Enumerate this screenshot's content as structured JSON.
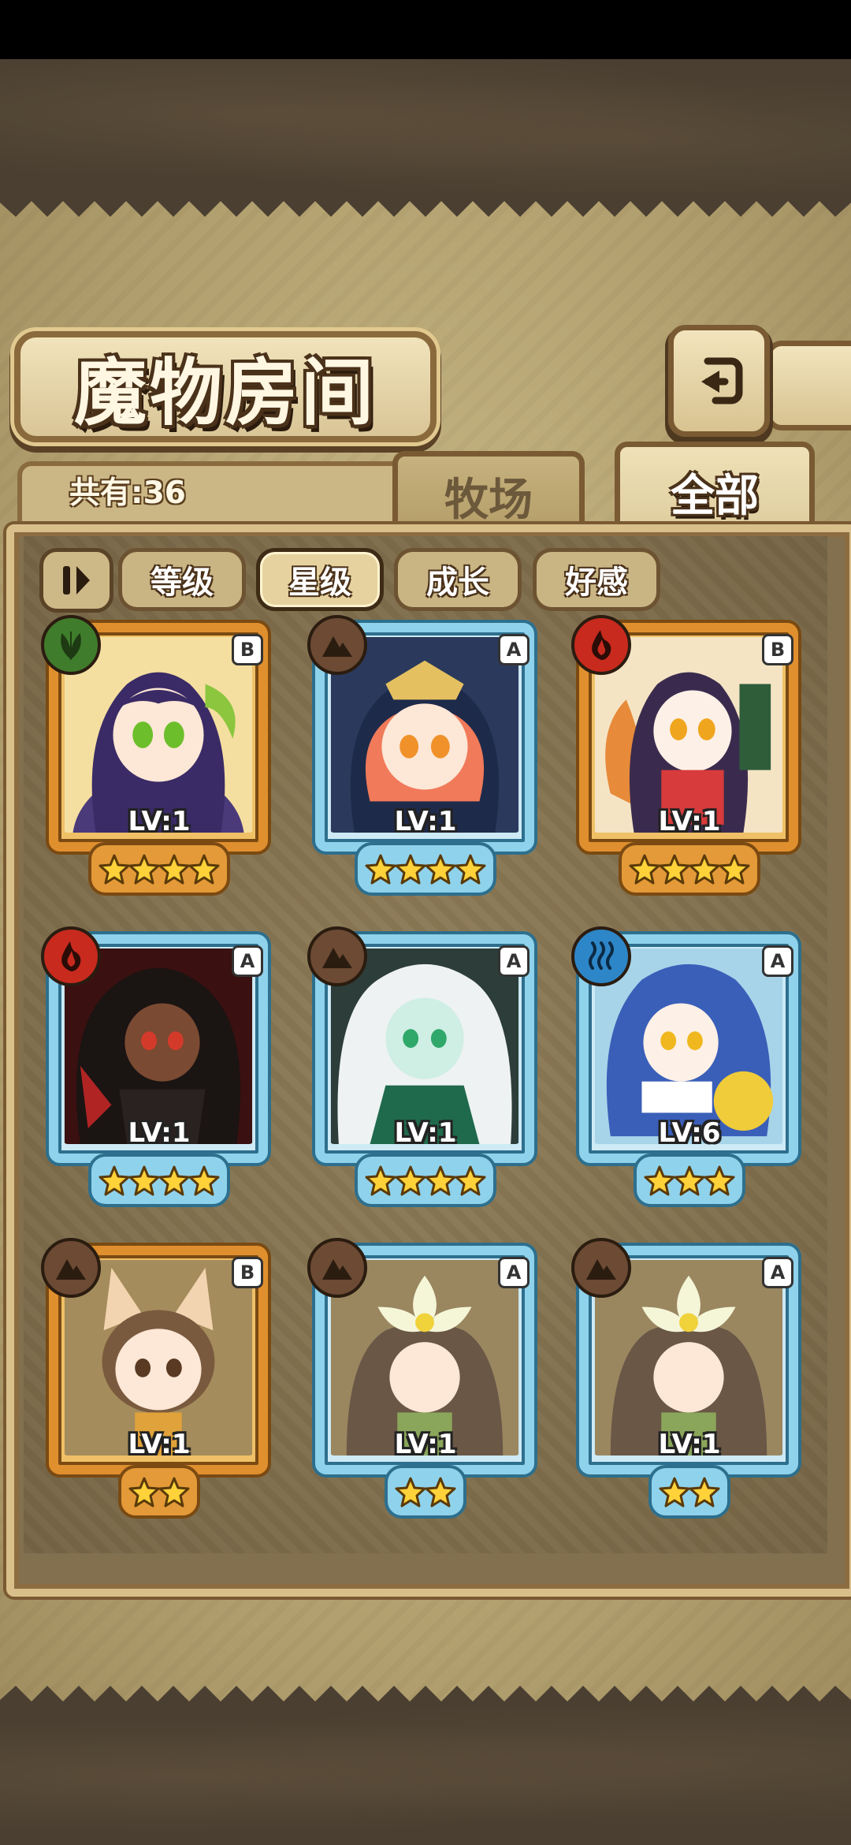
{
  "title": "魔物房间",
  "count_label": "共有:36",
  "tabs": {
    "ranch": "牧场",
    "all": "全部"
  },
  "filters": [
    "等级",
    "星级",
    "成长",
    "好感"
  ],
  "active_filter": "星级",
  "monsters": [
    {
      "level": "LV:1",
      "stars": 4,
      "rank": "B",
      "element": "grass"
    },
    {
      "level": "LV:1",
      "stars": 4,
      "rank": "A",
      "element": "earth"
    },
    {
      "level": "LV:1",
      "stars": 4,
      "rank": "B",
      "element": "fire"
    },
    {
      "level": "LV:1",
      "stars": 4,
      "rank": "A",
      "element": "fire"
    },
    {
      "level": "LV:1",
      "stars": 4,
      "rank": "A",
      "element": "earth"
    },
    {
      "level": "LV:6",
      "stars": 3,
      "rank": "A",
      "element": "water"
    },
    {
      "level": "LV:1",
      "stars": 2,
      "rank": "B",
      "element": "earth"
    },
    {
      "level": "LV:1",
      "stars": 2,
      "rank": "A",
      "element": "earth"
    },
    {
      "level": "LV:1",
      "stars": 2,
      "rank": "A",
      "element": "earth"
    }
  ],
  "colors": {
    "rank_B": "#e08f2e",
    "rank_A": "#8fd2ec",
    "star": "#ffd23a"
  },
  "icons": {
    "back": "return-arrow-icon",
    "sort": "sort-toggle-icon",
    "elements": {
      "grass": "leaf-icon",
      "earth": "mountain-icon",
      "fire": "flame-icon",
      "water": "steam-icon"
    }
  }
}
